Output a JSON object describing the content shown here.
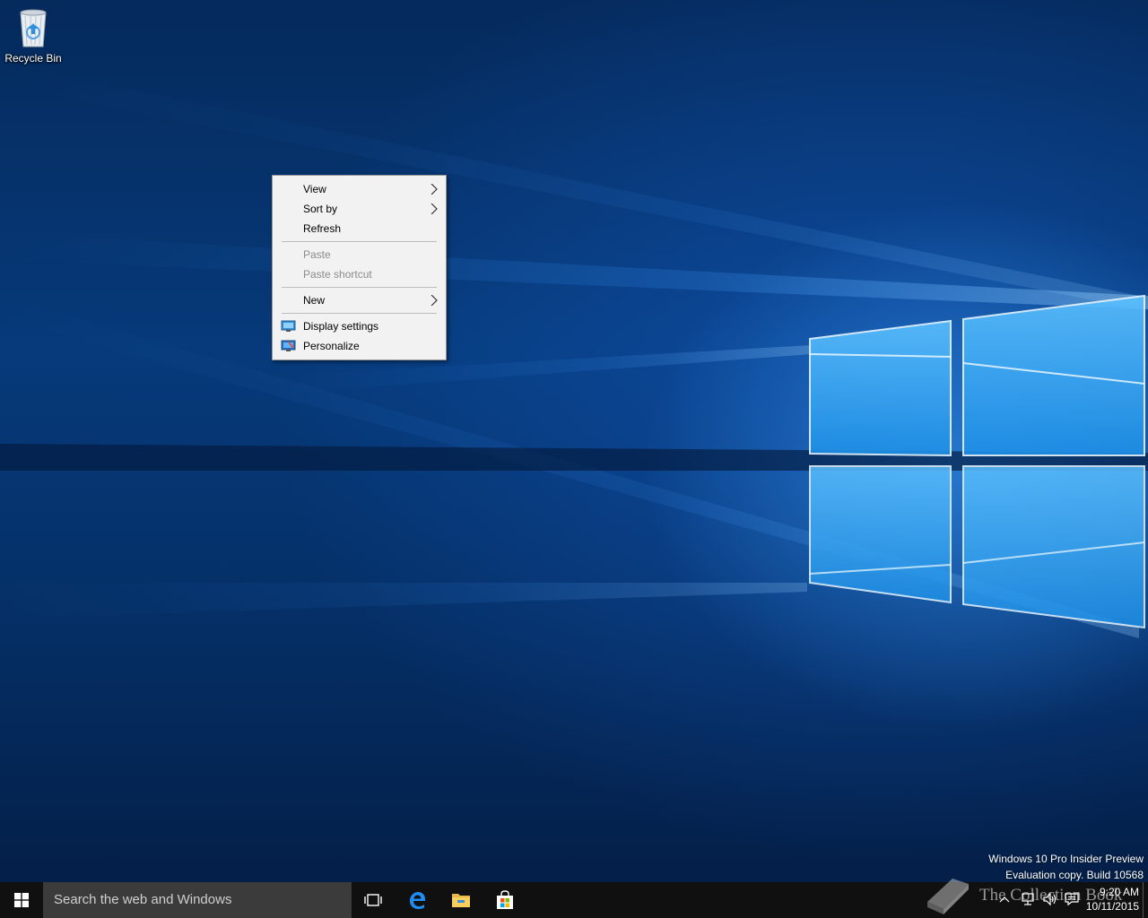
{
  "desktop": {
    "icons": [
      {
        "label": "Recycle Bin",
        "icon": "recycle-bin-icon"
      }
    ],
    "watermark": {
      "line1": "Windows 10 Pro Insider Preview",
      "line2": "Evaluation copy. Build 10568"
    },
    "overlay_watermark": "The Collection Book"
  },
  "context_menu": {
    "items": [
      {
        "label": "View",
        "submenu": true,
        "enabled": true
      },
      {
        "label": "Sort by",
        "submenu": true,
        "enabled": true
      },
      {
        "label": "Refresh",
        "submenu": false,
        "enabled": true
      },
      {
        "label": "Paste",
        "submenu": false,
        "enabled": false
      },
      {
        "label": "Paste shortcut",
        "submenu": false,
        "enabled": false
      },
      {
        "label": "New",
        "submenu": true,
        "enabled": true
      },
      {
        "label": "Display settings",
        "submenu": false,
        "enabled": true,
        "icon": "display-settings-icon"
      },
      {
        "label": "Personalize",
        "submenu": false,
        "enabled": true,
        "icon": "personalize-icon"
      }
    ]
  },
  "taskbar": {
    "search_placeholder": "Search the web and Windows",
    "pinned": [
      {
        "name": "Task View",
        "icon": "task-view-icon"
      },
      {
        "name": "Microsoft Edge",
        "icon": "edge-icon"
      },
      {
        "name": "File Explorer",
        "icon": "file-explorer-icon"
      },
      {
        "name": "Store",
        "icon": "store-icon"
      }
    ],
    "clock": {
      "time": "9:20 AM",
      "date": "10/11/2015"
    }
  },
  "colors": {
    "taskbar": "#101010",
    "search_box": "#3b3b3b",
    "menu_background": "#f2f2f2",
    "disabled_text": "#8c8c8c",
    "accent": "#0078d7"
  }
}
